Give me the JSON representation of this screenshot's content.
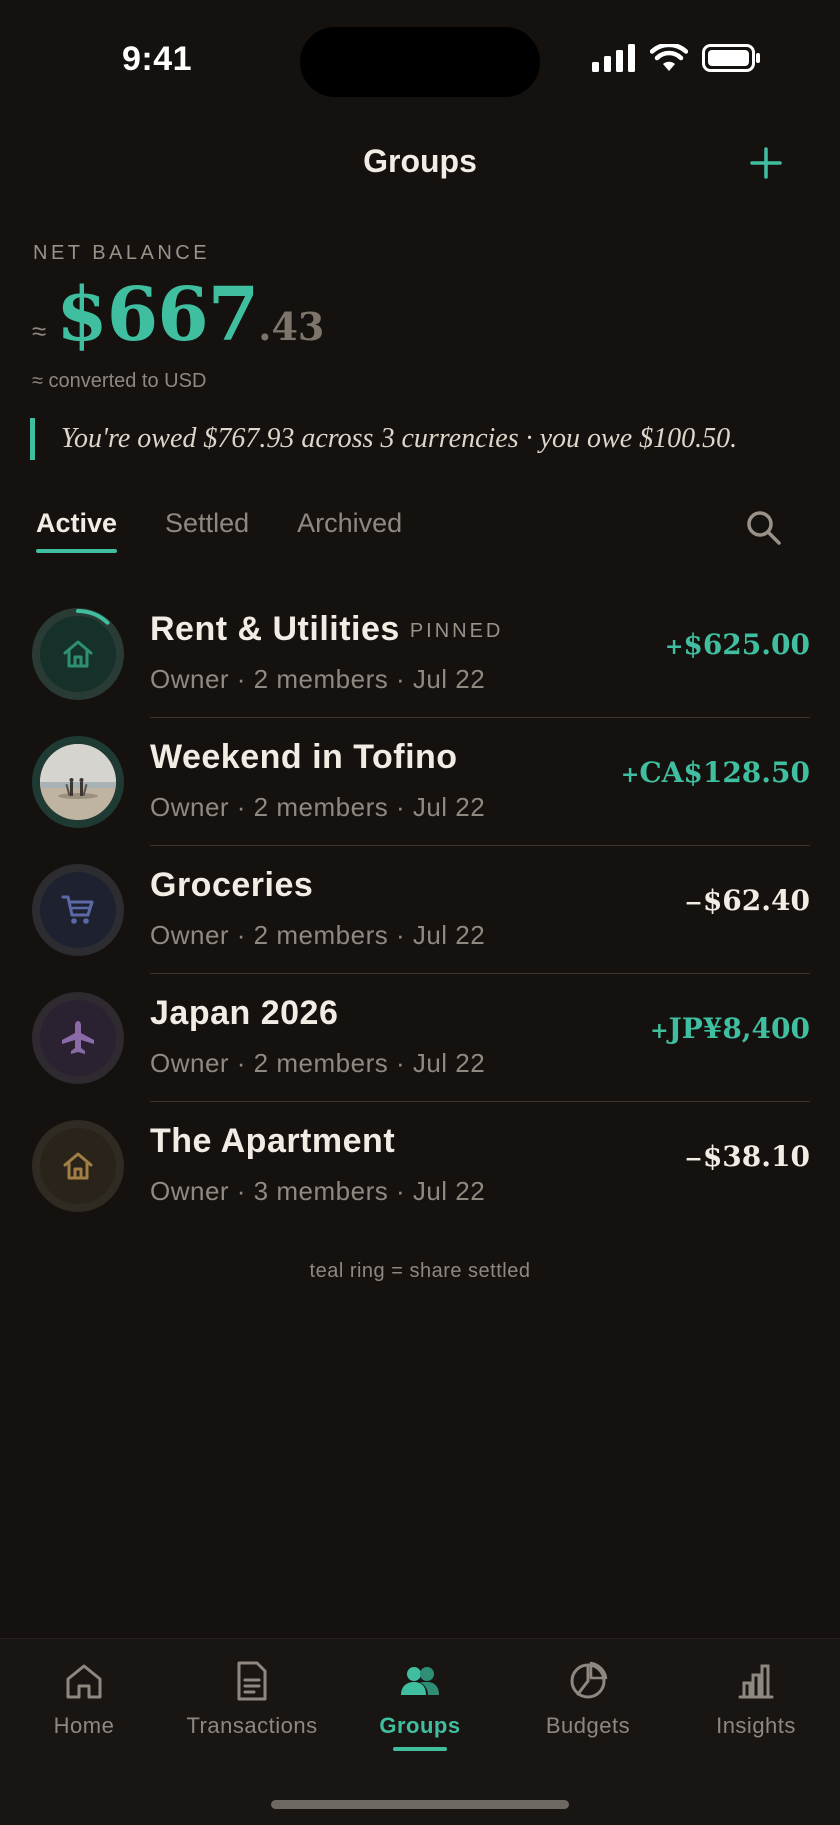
{
  "status_bar": {
    "time": "9:41"
  },
  "header": {
    "title": "Groups"
  },
  "net_balance": {
    "label": "NET BALANCE",
    "approx": "≈",
    "amount_main": "$667",
    "amount_cents": ".43",
    "converted": "≈ converted to USD",
    "summary": "You're owed $767.93 across 3 currencies · you owe $100.50."
  },
  "tabs": [
    {
      "label": "Active",
      "active": true
    },
    {
      "label": "Settled",
      "active": false
    },
    {
      "label": "Archived",
      "active": false
    }
  ],
  "groups": [
    {
      "name": "Rent & Utilities",
      "badge": "PINNED",
      "subtitle": "Owner · 2 members · Jul 22",
      "amount": "$625.00",
      "sign": "+",
      "positive": true,
      "icon": "home-icon",
      "icon_color": "#2f8f75",
      "ring_color": "#2a3b35",
      "fill": "#16302a",
      "settled_share": 0.12
    },
    {
      "name": "Weekend in Tofino",
      "badge": "",
      "subtitle": "Owner · 2 members · Jul 22",
      "amount": "CA$128.50",
      "sign": "+",
      "positive": true,
      "icon": "beach-photo",
      "ring_color": "#1f3a33",
      "settled_share": 0
    },
    {
      "name": "Groceries",
      "badge": "",
      "subtitle": "Owner · 2 members · Jul 22",
      "amount": "$62.40",
      "sign": "−",
      "positive": false,
      "icon": "cart-icon",
      "icon_color": "#5b6aa6",
      "ring_color": "#2d2c31",
      "fill": "#1e2230",
      "settled_share": 0
    },
    {
      "name": "Japan 2026",
      "badge": "",
      "subtitle": "Owner · 2 members · Jul 22",
      "amount": "JP¥8,400",
      "sign": "+",
      "positive": true,
      "icon": "plane-icon",
      "icon_color": "#8b6aa8",
      "ring_color": "#2e2a30",
      "fill": "#2a2230",
      "settled_share": 0
    },
    {
      "name": "The Apartment",
      "badge": "",
      "subtitle": "Owner · 3 members · Jul 22",
      "amount": "$38.10",
      "sign": "−",
      "positive": false,
      "icon": "home-icon",
      "icon_color": "#a07e45",
      "ring_color": "#2f2a22",
      "fill": "#2a231a",
      "settled_share": 0
    }
  ],
  "legend_note": "teal ring = share settled",
  "tabbar": [
    {
      "label": "Home",
      "icon": "home-icon",
      "active": false
    },
    {
      "label": "Transactions",
      "icon": "document-icon",
      "active": false
    },
    {
      "label": "Groups",
      "icon": "people-icon",
      "active": true
    },
    {
      "label": "Budgets",
      "icon": "pie-chart-icon",
      "active": false
    },
    {
      "label": "Insights",
      "icon": "bar-chart-icon",
      "active": false
    }
  ],
  "colors": {
    "accent": "#3fbf9f",
    "background": "#14110f"
  }
}
